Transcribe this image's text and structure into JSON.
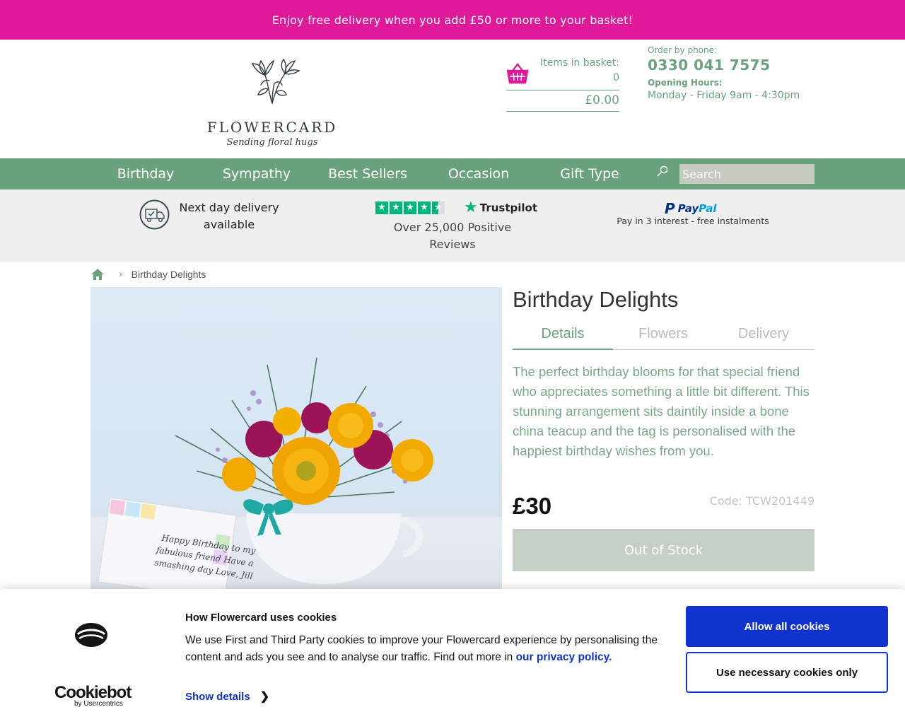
{
  "promo": {
    "text": "Enjoy free delivery when you add £50 or more to your basket!"
  },
  "brand": {
    "name": "FLOWERCARD",
    "tagline": "Sending floral hugs",
    "accent": "#6aa27e",
    "promo_color": "#e0199a"
  },
  "basket": {
    "label": "Items in basket:",
    "count": "0",
    "total": "£0.00"
  },
  "contact": {
    "order_label": "Order by phone:",
    "phone": "0330 041 7575",
    "hours_label": "Opening Hours:",
    "hours": "Monday - Friday 9am - 4:30pm"
  },
  "nav": {
    "items": [
      {
        "label": "Birthday"
      },
      {
        "label": "Sympathy"
      },
      {
        "label": "Best Sellers"
      },
      {
        "label": "Occasion"
      },
      {
        "label": "Gift Type"
      }
    ],
    "search_placeholder": "Search"
  },
  "usps": {
    "delivery": "Next day delivery available",
    "trustpilot_brand": "Trustpilot",
    "trustpilot_text": "Over 25,000 Positive Reviews",
    "paypal_brand_1": "Pay",
    "paypal_brand_2": "Pal",
    "paypal_text": "Pay in 3 interest - free instalments"
  },
  "breadcrumb": {
    "current": "Birthday Delights"
  },
  "product": {
    "title": "Birthday Delights",
    "tabs": [
      {
        "label": "Details",
        "active": true
      },
      {
        "label": "Flowers",
        "active": false
      },
      {
        "label": "Delivery",
        "active": false
      }
    ],
    "description": "The perfect birthday blooms for that special friend who appreciates something a little bit different. This stunning arrangement sits daintily inside a bone china teacup and the tag is personalised with the happiest birthday wishes from you.",
    "price": "£30",
    "code": "Code: TCW201449",
    "stock_button": "Out of Stock",
    "card_text": "Happy Birthday to my fabulous friend Have a smashing day Love, Jill"
  },
  "cookies": {
    "provider_name": "Cookiebot",
    "provider_sub": "by Usercentrics",
    "title": "How Flowercard uses cookies",
    "text": "We use First and Third Party cookies to improve your Flowercard experience by personalising the content and ads you see and to analyse our traffic. Find out more in",
    "link": "our privacy policy.",
    "show_details": "Show details",
    "allow_all": "Allow all cookies",
    "necessary_only": "Use necessary cookies only",
    "button_color": "#1032cf"
  }
}
